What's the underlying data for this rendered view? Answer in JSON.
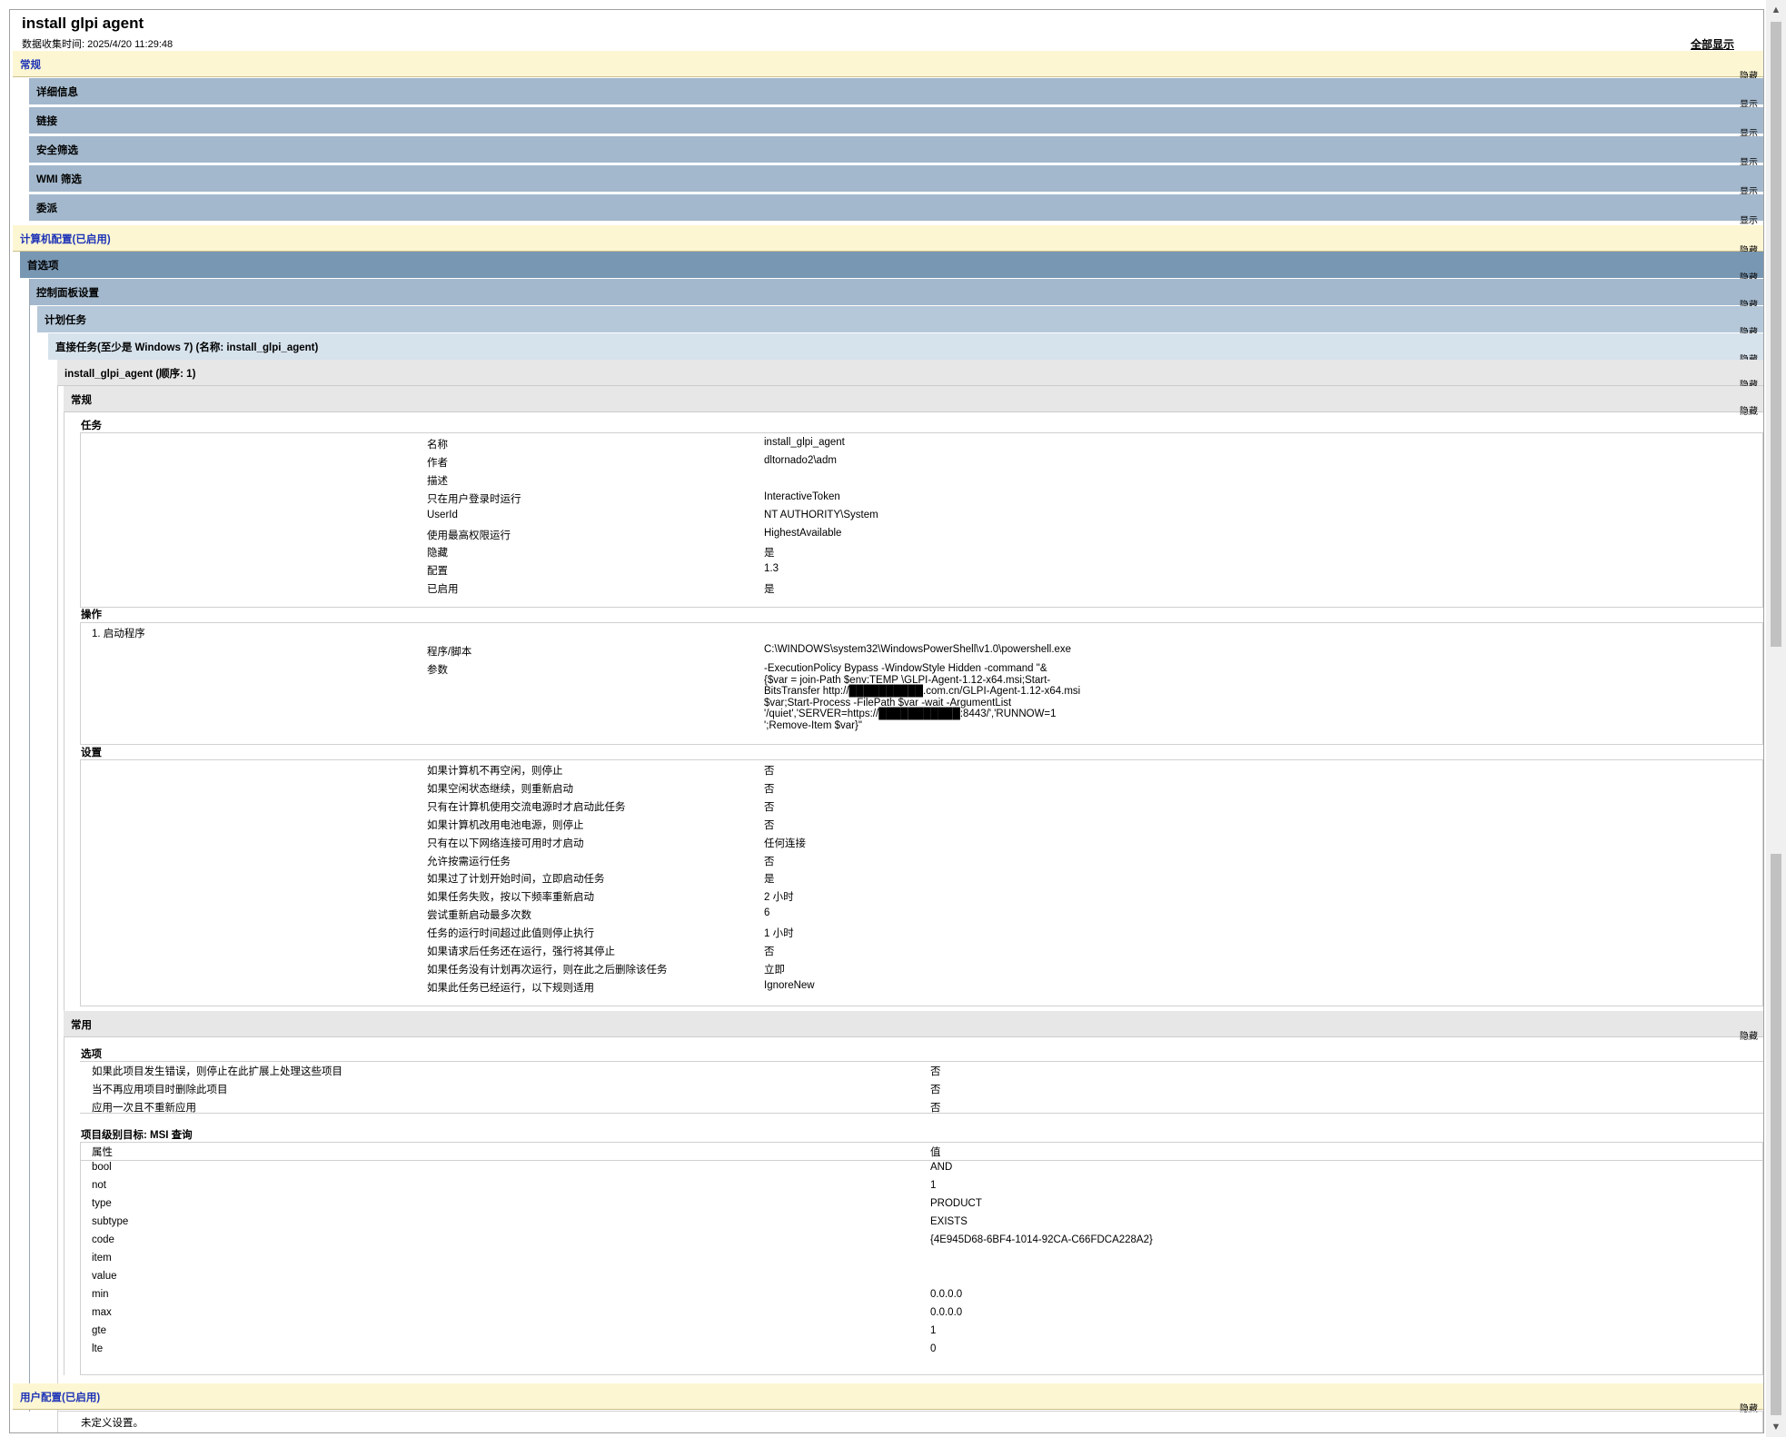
{
  "header": {
    "title": "install glpi agent",
    "collected_time": "数据收集时间: 2025/4/20 11:29:48",
    "show_all": "全部显示"
  },
  "toggles": {
    "hide": "隐藏",
    "show": "显示"
  },
  "bars": {
    "general": "常规",
    "details": "详细信息",
    "links": "链接",
    "security_filter": "安全筛选",
    "wmi_filter": "WMI 筛选",
    "delegation": "委派",
    "computer_config": "计算机配置(已启用)",
    "preferences": "首选项",
    "control_panel": "控制面板设置",
    "scheduled_tasks": "计划任务",
    "immediate_task": "直接任务(至少是 Windows 7) (名称: install_glpi_agent)",
    "task_item": "install_glpi_agent (顺序: 1)",
    "task_general": "常规",
    "common": "常用",
    "user_config": "用户配置(已启用)"
  },
  "task": {
    "heading": "任务",
    "rows": [
      {
        "k": "名称",
        "v": "install_glpi_agent"
      },
      {
        "k": "作者",
        "v": "dltornado2\\adm"
      },
      {
        "k": "描述",
        "v": ""
      },
      {
        "k": "只在用户登录时运行",
        "v": "InteractiveToken"
      },
      {
        "k": "UserId",
        "v": "NT AUTHORITY\\System"
      },
      {
        "k": "使用最高权限运行",
        "v": "HighestAvailable"
      },
      {
        "k": "隐藏",
        "v": "是"
      },
      {
        "k": "配置",
        "v": "1.3"
      },
      {
        "k": "已启用",
        "v": "是"
      }
    ]
  },
  "actions": {
    "heading": "操作",
    "item": "1. 启动程序",
    "program_label": "程序/脚本",
    "program_value": "C:\\WINDOWS\\system32\\WindowsPowerShell\\v1.0\\powershell.exe",
    "args_label": "参数",
    "args_lines": [
      "-ExecutionPolicy Bypass -WindowStyle Hidden -command \"&",
      "{$var = join-Path $env:TEMP \\GLPI-Agent-1.12-x64.msi;Start-",
      "BitsTransfer http://██████████.com.cn/GLPI-Agent-1.12-x64.msi",
      "$var;Start-Process -FilePath $var -wait -ArgumentList",
      "'/quiet','SERVER=https://███████████:8443/','RUNNOW=1",
      "';Remove-Item $var}\""
    ]
  },
  "settings": {
    "heading": "设置",
    "rows": [
      {
        "k": "如果计算机不再空闲，则停止",
        "v": "否"
      },
      {
        "k": "如果空闲状态继续，则重新启动",
        "v": "否"
      },
      {
        "k": "只有在计算机使用交流电源时才启动此任务",
        "v": "否"
      },
      {
        "k": "如果计算机改用电池电源，则停止",
        "v": "否"
      },
      {
        "k": "只有在以下网络连接可用时才启动",
        "v": "任何连接"
      },
      {
        "k": "允许按需运行任务",
        "v": "否"
      },
      {
        "k": "如果过了计划开始时间，立即启动任务",
        "v": "是"
      },
      {
        "k": "如果任务失败，按以下频率重新启动",
        "v": "2 小时"
      },
      {
        "k": "尝试重新启动最多次数",
        "v": "6"
      },
      {
        "k": "任务的运行时间超过此值则停止执行",
        "v": "1 小时"
      },
      {
        "k": "如果请求后任务还在运行，强行将其停止",
        "v": "否"
      },
      {
        "k": "如果任务没有计划再次运行，则在此之后删除该任务",
        "v": "立即"
      },
      {
        "k": "如果此任务已经运行，以下规则适用",
        "v": "IgnoreNew"
      }
    ]
  },
  "options": {
    "heading": "选项",
    "rows": [
      {
        "k": "如果此项目发生错误，则停止在此扩展上处理这些项目",
        "v": "否"
      },
      {
        "k": "当不再应用项目时删除此项目",
        "v": "否"
      },
      {
        "k": "应用一次且不重新应用",
        "v": "否"
      }
    ]
  },
  "targeting": {
    "heading": "项目级别目标: MSI 查询",
    "col_attr": "属性",
    "col_val": "值",
    "rows": [
      {
        "k": "bool",
        "v": "AND"
      },
      {
        "k": "not",
        "v": "1"
      },
      {
        "k": "type",
        "v": "PRODUCT"
      },
      {
        "k": "subtype",
        "v": "EXISTS"
      },
      {
        "k": "code",
        "v": "{4E945D68-6BF4-1014-92CA-C66FDCA228A2}"
      },
      {
        "k": "item",
        "v": ""
      },
      {
        "k": "value",
        "v": ""
      },
      {
        "k": "min",
        "v": "0.0.0.0"
      },
      {
        "k": "max",
        "v": "0.0.0.0"
      },
      {
        "k": "gte",
        "v": "1"
      },
      {
        "k": "lte",
        "v": "0"
      }
    ]
  },
  "user_config_note": "未定义设置。"
}
